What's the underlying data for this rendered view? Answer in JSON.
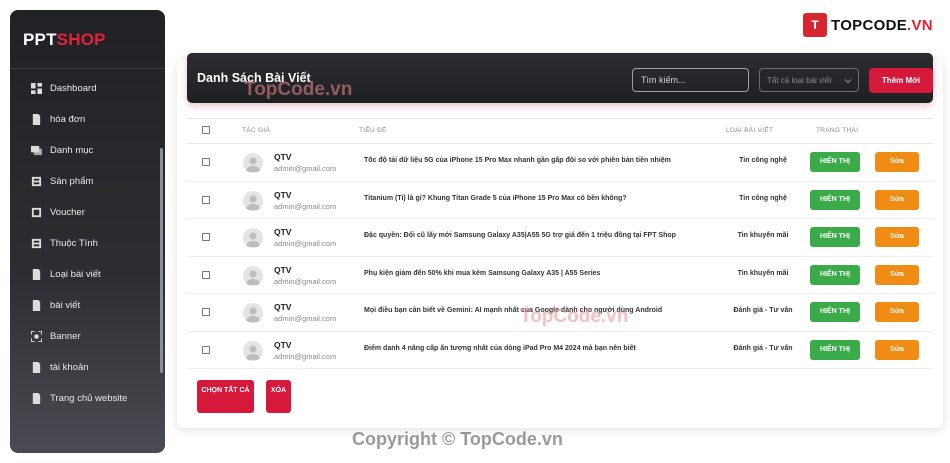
{
  "brand": {
    "part1": "PPT",
    "part2": "SHOP"
  },
  "sidebar": {
    "items": [
      {
        "label": "Dashboard",
        "icon": "dashboard-icon"
      },
      {
        "label": "hóa đơn",
        "icon": "invoice-icon"
      },
      {
        "label": "Danh mục",
        "icon": "category-icon"
      },
      {
        "label": "Sản phẩm",
        "icon": "product-icon"
      },
      {
        "label": "Voucher",
        "icon": "voucher-icon"
      },
      {
        "label": "Thuộc Tính",
        "icon": "attribute-icon"
      },
      {
        "label": "Loại bài viết",
        "icon": "post-type-icon"
      },
      {
        "label": "bài viết",
        "icon": "post-icon"
      },
      {
        "label": "Banner",
        "icon": "banner-icon"
      },
      {
        "label": "tài khoản",
        "icon": "account-icon"
      },
      {
        "label": "Trang chủ website",
        "icon": "home-icon"
      }
    ]
  },
  "logo": {
    "mark": "T",
    "text": "TOPCODE",
    "suffix": ".VN"
  },
  "header": {
    "title": "Danh Sách Bài Viết",
    "search_placeholder": "Tìm kiếm...",
    "select_value": "Tất cả loại bài viết",
    "new_button": "Thêm Mới"
  },
  "table": {
    "columns": [
      "Tác giả",
      "Tiêu đề",
      "Loại bài viết",
      "Trạng thái"
    ],
    "rows": [
      {
        "name": "QTV",
        "email": "admin@gmail.com",
        "title": "Tốc độ tải dữ liệu 5G của iPhone 15 Pro Max nhanh gần gấp đôi so với phiên bản tiền nhiệm",
        "category": "Tin công nghệ",
        "status": "HIỂN THỊ",
        "edit": "Sửa"
      },
      {
        "name": "QTV",
        "email": "admin@gmail.com",
        "title": "Titanium (Ti) là gì? Khung Titan Grade 5 của iPhone 15 Pro Max có bền không?",
        "category": "Tin công nghệ",
        "status": "HIỂN THỊ",
        "edit": "Sửa"
      },
      {
        "name": "QTV",
        "email": "admin@gmail.com",
        "title": "Đặc quyền: Đổi cũ lấy mới Samsung Galaxy A35|A55 5G trợ giá đến 1 triệu đồng tại FPT Shop",
        "category": "Tin khuyến mãi",
        "status": "HIỂN THỊ",
        "edit": "Sửa"
      },
      {
        "name": "QTV",
        "email": "admin@gmail.com",
        "title": "Phụ kiện giảm đến 50% khi mua kèm Samsung Galaxy A35 | A55 Series",
        "category": "Tin khuyến mãi",
        "status": "HIỂN THỊ",
        "edit": "Sửa"
      },
      {
        "name": "QTV",
        "email": "admin@gmail.com",
        "title": "Mọi điều bạn cần biết về Gemini: AI mạnh nhất của Google dành cho người dùng Android",
        "category": "Đánh giá - Tư vấn",
        "status": "HIỂN THỊ",
        "edit": "Sửa"
      },
      {
        "name": "QTV",
        "email": "admin@gmail.com",
        "title": "Điểm danh 4 nâng cấp ấn tượng nhất của dòng iPad Pro M4 2024 mà bạn nên biết",
        "category": "Đánh giá - Tư vấn",
        "status": "HIỂN THỊ",
        "edit": "Sửa"
      }
    ]
  },
  "bulk": {
    "select_all": "CHỌN TẤT CẢ",
    "delete": "XÓA"
  },
  "watermarks": {
    "top": "TopCode.vn",
    "middle": "TopCode.vn"
  },
  "copyright": "Copyright © TopCode.vn",
  "colors": {
    "accent": "#d6193a",
    "status": "#3bab4a",
    "edit": "#f08c13",
    "sidebar": "#202124"
  }
}
